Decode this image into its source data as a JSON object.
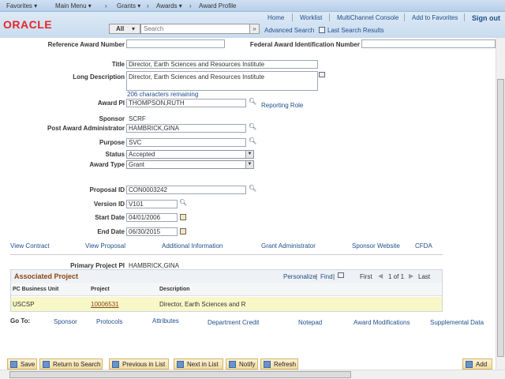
{
  "nav": {
    "favorites": "Favorites",
    "main_menu": "Main Menu",
    "grants": "Grants",
    "awards": "Awards",
    "award_profile": "Award Profile"
  },
  "header": {
    "logo": "ORACLE",
    "links": [
      "Home",
      "Worklist",
      "MultiChannel Console",
      "Add to Favorites",
      "Sign out"
    ],
    "search_scope": "All",
    "search_placeholder": "Search",
    "advanced_search": "Advanced Search",
    "last_search_results": "Last Search Results"
  },
  "form": {
    "reference_award_number": {
      "label": "Reference Award Number",
      "value": ""
    },
    "federal_award_id": {
      "label": "Federal Award Identification Number",
      "value": ""
    },
    "title": {
      "label": "Title",
      "value": "Director, Earth Sciences and Resources Institute"
    },
    "long_description": {
      "label": "Long Description",
      "value": "Director, Earth Sciences and Resources Institute",
      "remaining": "206 characters remaining"
    },
    "award_pi": {
      "label": "Award PI",
      "value": "THOMPSON,RUTH",
      "link": "Reporting Role"
    },
    "sponsor": {
      "label": "Sponsor",
      "value": "SCRF"
    },
    "post_award_admin": {
      "label": "Post Award Administrator",
      "value": "HAMBRICK,GINA"
    },
    "purpose": {
      "label": "Purpose",
      "value": "SVC"
    },
    "status": {
      "label": "Status",
      "value": "Accepted"
    },
    "award_type": {
      "label": "Award Type",
      "value": "Grant"
    },
    "proposal_id": {
      "label": "Proposal ID",
      "value": "CON0003242"
    },
    "version_id": {
      "label": "Version ID",
      "value": "V101"
    },
    "start_date": {
      "label": "Start Date",
      "value": "04/01/2006"
    },
    "end_date": {
      "label": "End Date",
      "value": "06/30/2015"
    }
  },
  "links": [
    "View Contract",
    "View Proposal",
    "Additional Information",
    "Grant Administrator",
    "Sponsor Website",
    "CFDA"
  ],
  "primary_pi": {
    "label": "Primary Project PI",
    "value": "HAMBRICK,GINA"
  },
  "grid": {
    "title": "Associated Project",
    "personalize": "Personalize",
    "find": "Find",
    "first": "First",
    "page": "1 of 1",
    "last": "Last",
    "columns": [
      "PC Business Unit",
      "Project",
      "Description"
    ],
    "rows": [
      [
        "USCSP",
        "10006531",
        "Director, Earth Sciences and R"
      ]
    ]
  },
  "goto": {
    "label": "Go To:",
    "links": [
      "Sponsor",
      "Protocols",
      "Attributes",
      "Department Credit",
      "Notepad",
      "Award Modifications",
      "Supplemental Data"
    ]
  },
  "toolbar": {
    "save": "Save",
    "return": "Return to Search",
    "prev": "Previous in List",
    "next": "Next in List",
    "notify": "Notify",
    "refresh": "Refresh",
    "add": "Add"
  }
}
